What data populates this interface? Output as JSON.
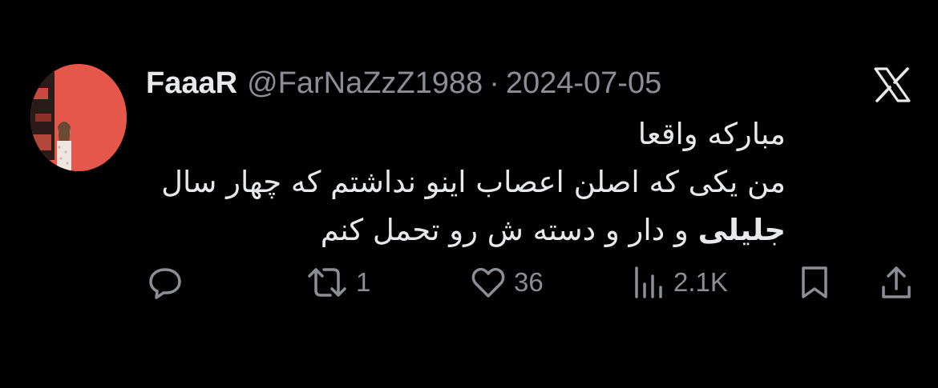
{
  "tweet": {
    "display_name": "FaaaR",
    "handle": "@FarNaZzZ1988",
    "separator": "·",
    "date": "2024-07-05",
    "text_lines": [
      "مبارکه واقعا",
      "من یکی که اصلن اعصاب اینو نداشتم که چهار سال",
      "و دار و دسته ش رو تحمل کنم"
    ],
    "bold_word": "جلیلی",
    "platform_icon": "x-logo-icon"
  },
  "actions": {
    "reply": {
      "icon": "reply-icon",
      "count": ""
    },
    "retweet": {
      "icon": "retweet-icon",
      "count": "1"
    },
    "like": {
      "icon": "heart-icon",
      "count": "36"
    },
    "views": {
      "icon": "views-chart-icon",
      "count": "2.1K"
    },
    "bookmark": {
      "icon": "bookmark-icon",
      "count": ""
    },
    "share": {
      "icon": "share-icon",
      "count": ""
    }
  },
  "colors": {
    "background": "#000000",
    "text": "#e7e9ea",
    "muted": "#8b8f94",
    "avatar_bg": "#e4574a"
  }
}
